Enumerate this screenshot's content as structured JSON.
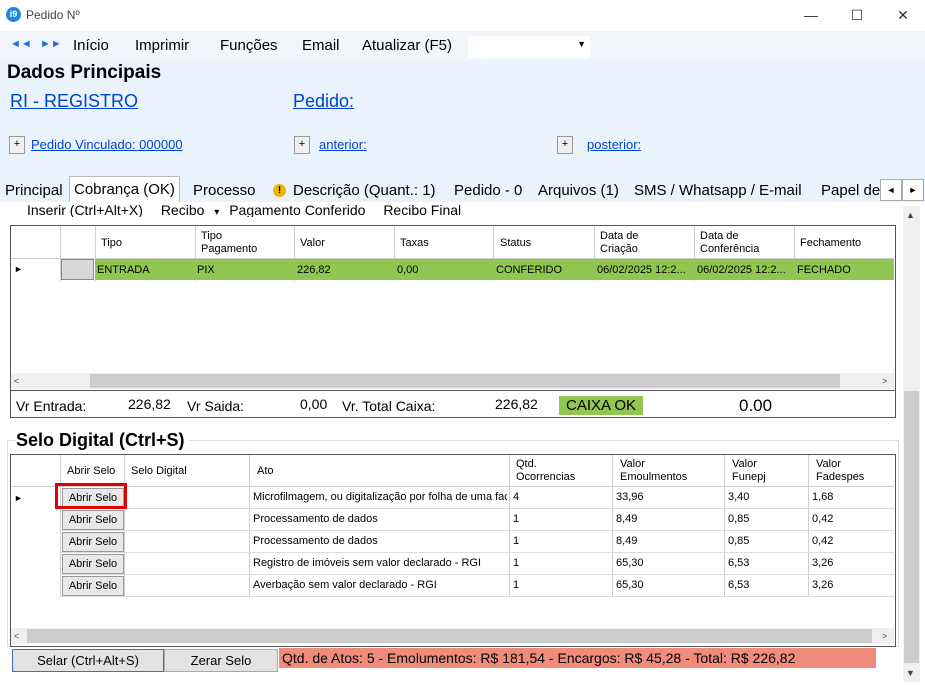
{
  "window": {
    "title": "Pedido Nº",
    "minimize": "—",
    "maximize": "☐",
    "close": "✕",
    "app_icon": "i9"
  },
  "menu": {
    "back_icon": "◄◄",
    "forward_icon": "►►",
    "items": [
      "Início",
      "Imprimir",
      "Funções",
      "Email",
      "Atualizar (F5)"
    ],
    "combo_value": ""
  },
  "header": {
    "title": "Dados Principais",
    "registry_link": "RI - REGISTRO",
    "pedido_link": "Pedido:",
    "plus": "+",
    "vinculado_link": "Pedido Vinculado: 000000",
    "anterior_link": "anterior:",
    "posterior_link": "posterior:"
  },
  "tabs": [
    "Principal",
    "Cobrança (OK)",
    "Processo",
    "Descrição (Quant.: 1)",
    "Pedido - 0",
    "Arquivos (1)",
    "SMS / Whatsapp / E-mail",
    "Papel de"
  ],
  "tab_warning_icon": "!",
  "cobranca": {
    "toolbar": [
      "Inserir (Ctrl+Alt+X)",
      "Recibo",
      "▾",
      "Pagamento Conferido",
      "Recibo Final"
    ],
    "columns": [
      "Tipo",
      "Tipo Pagamento",
      "Valor",
      "Taxas",
      "Status",
      "Data de Criação",
      "Data de Conferência",
      "Fechamento"
    ],
    "rows": [
      {
        "tipo": "ENTRADA",
        "tipo_pagamento": "PIX",
        "valor": "226,82",
        "taxas": "0,00",
        "status": "CONFERIDO",
        "data_criacao": "06/02/2025 12:2...",
        "data_conferencia": "06/02/2025 12:2...",
        "fechamento": "FECHADO"
      }
    ],
    "totals": {
      "entrada_label": "Vr Entrada:",
      "entrada_value": "226,82",
      "saida_label": "Vr Saida:",
      "saida_value": "0,00",
      "total_label": "Vr. Total Caixa:",
      "total_value": "226,82",
      "status": "CAIXA OK",
      "saldo": "0.00"
    }
  },
  "selo": {
    "title": "Selo Digital (Ctrl+S)",
    "columns": [
      "Abrir Selo",
      "Selo Digital",
      "Ato",
      "Qtd. Ocorrencias",
      "Valor Emoulmentos",
      "Valor Funepj",
      "Valor Fadespes"
    ],
    "rows": [
      {
        "button": "Abrir Selo",
        "selo": "",
        "ato": "Microfilmagem, ou digitalização por folha de uma face",
        "qtd": "4",
        "emolumentos": "33,96",
        "funepj": "3,40",
        "fadespes": "1,68"
      },
      {
        "button": "Abrir Selo",
        "selo": "",
        "ato": "Processamento de dados",
        "qtd": "1",
        "emolumentos": "8,49",
        "funepj": "0,85",
        "fadespes": "0,42"
      },
      {
        "button": "Abrir Selo",
        "selo": "",
        "ato": "Processamento de dados",
        "qtd": "1",
        "emolumentos": "8,49",
        "funepj": "0,85",
        "fadespes": "0,42"
      },
      {
        "button": "Abrir Selo",
        "selo": "",
        "ato": "Registro de imóveis sem valor declarado - RGI",
        "qtd": "1",
        "emolumentos": "65,30",
        "funepj": "6,53",
        "fadespes": "3,26"
      },
      {
        "button": "Abrir Selo",
        "selo": "",
        "ato": "Averbação sem valor declarado - RGI",
        "qtd": "1",
        "emolumentos": "65,30",
        "funepj": "6,53",
        "fadespes": "3,26"
      }
    ],
    "selar_button": "Selar (Ctrl+Alt+S)",
    "zerar_button": "Zerar Selo",
    "summary": "Qtd. de Atos: 5   -   Emolumentos: R$ 181,54   -   Encargos: R$ 45,28   -   Total: R$ 226,82"
  },
  "icons": {
    "row_indicator": "►",
    "scroll_up": "▲",
    "scroll_down": "▼",
    "scroll_left": "<",
    "scroll_right": ">",
    "tab_left": "◄",
    "tab_right": "►"
  },
  "colors": {
    "accent_green": "#92c653",
    "summary_red": "#f08c7c",
    "link_blue": "#0044cc",
    "highlight_red": "#e00000"
  }
}
